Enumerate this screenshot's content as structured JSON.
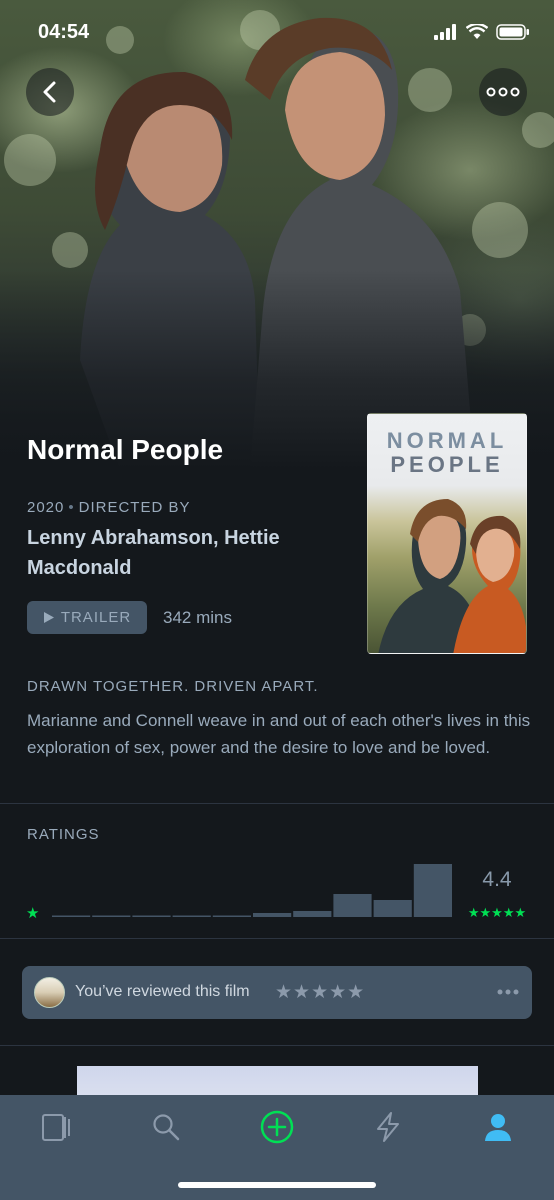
{
  "status_bar": {
    "time": "04:54"
  },
  "film": {
    "title": "Normal People",
    "year": "2020",
    "directed_by_label": "DIRECTED BY",
    "directors": "Lenny Abrahamson, Hettie Macdonald",
    "trailer_label": "TRAILER",
    "runtime": "342 mins",
    "poster_title_line1": "NORMAL",
    "poster_title_line2": "PEOPLE",
    "tagline": "DRAWN TOGETHER. DRIVEN APART.",
    "synopsis": "Marianne and Connell weave in and out of each other's lives in this exploration of sex, power and the desire to love and be loved."
  },
  "ratings": {
    "label": "RATINGS",
    "average": "4.4",
    "low_star": "★",
    "high_stars": "★★★★★"
  },
  "chart_data": {
    "type": "bar",
    "categories": [
      "0.5",
      "1",
      "1.5",
      "2",
      "2.5",
      "3",
      "3.5",
      "4",
      "4.5",
      "5"
    ],
    "values": [
      1,
      1,
      1,
      1,
      1,
      4,
      6,
      23,
      17,
      53
    ],
    "title": "",
    "xlabel": "",
    "ylabel": "",
    "grid": false
  },
  "review": {
    "text": "You’ve reviewed this film",
    "stars": "★★★★★"
  },
  "colors": {
    "accent_green": "#00e054",
    "tab_active_blue": "#40bcf4",
    "panel": "#445566",
    "text_muted": "#99aabb"
  },
  "tabs": [
    {
      "icon": "films-icon"
    },
    {
      "icon": "search-icon"
    },
    {
      "icon": "add-icon"
    },
    {
      "icon": "activity-icon"
    },
    {
      "icon": "profile-icon"
    }
  ]
}
